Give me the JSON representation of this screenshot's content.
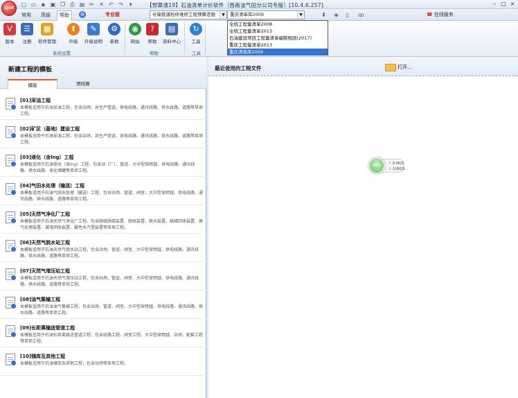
{
  "titlebar": {
    "logo_text": "Lyst",
    "title": "【预算通19】石油清单计价软件（西南油气田分公司专版）[10.4.6.257]",
    "quick_access": [
      "new-icon",
      "open-icon",
      "save-icon",
      "save-all-icon",
      "copy-icon",
      "print-icon",
      "preview-icon",
      "cut-icon",
      "delete-icon",
      "undo-icon",
      "redo-icon"
    ],
    "window_buttons": [
      "–",
      "□",
      "×"
    ]
  },
  "tabs": {
    "items": [
      "常用",
      "高级",
      "帮助"
    ],
    "active_index": 2,
    "edition": "专业版",
    "combo_left": "长输管道检修维修工程预算定额",
    "combo_right": "重庆清单库2009",
    "service": "在线服务"
  },
  "ribbon": {
    "buttons": [
      {
        "label": "版本",
        "icon": "version-icon",
        "color": "#d43a3a",
        "glyph": "V"
      },
      {
        "label": "注册",
        "icon": "register-icon",
        "color": "#3b6cb8",
        "glyph": "☰"
      },
      {
        "label": "软件管理",
        "icon": "software-manage-icon",
        "color": "#e2a21c",
        "glyph": "▦"
      },
      {
        "label": "升级",
        "icon": "upgrade-icon",
        "color": "#e8821c",
        "glyph": "⬆"
      },
      {
        "label": "升级说明",
        "icon": "upgrade-notes-icon",
        "color": "#3a7bd0",
        "glyph": "✎"
      },
      {
        "label": "参数",
        "icon": "parameters-icon",
        "color": "#2d6cc4",
        "glyph": "⚙"
      },
      {
        "label": "网站",
        "icon": "website-icon",
        "color": "#2a9a3e",
        "glyph": "◉"
      },
      {
        "label": "帮助",
        "icon": "help-icon",
        "color": "#c92a2a",
        "glyph": "?"
      },
      {
        "label": "资料中心",
        "icon": "data-center-icon",
        "color": "#3b6cb8",
        "glyph": "▤"
      },
      {
        "label": "工具",
        "icon": "tools-icon",
        "color": "#2d7fd8",
        "glyph": "↻"
      }
    ],
    "groups": [
      "系统设置",
      "帮助",
      "工具"
    ]
  },
  "dropdown": {
    "options": [
      "全统工程量清单2008",
      "全统工程量清单2013",
      "石油建设项目工程量清单编制规则(2017)",
      "重庆工程量清单2013",
      "重庆清单库2009"
    ],
    "selected_index": 4
  },
  "left_panel": {
    "title": "新建工程的模板",
    "tabs": [
      "模版",
      "预结算"
    ],
    "active_tab": 0,
    "items": [
      {
        "name": "[01]采油工程",
        "desc": "本模板适用于石油采油工程，包含站场、井生产管道、供电线路、通讯线路、供水线路、道路等单项工程。"
      },
      {
        "name": "[02]矿区（基地）建设工程",
        "desc": "本模板适用于石油采油工程，包含站场、井生产管道、供电线路、通讯线路、供水线路、道路等单项工程。"
      },
      {
        "name": "[03]液化（含lng）工程",
        "desc": "本模板适用于石油液化（含lng）工程，包含站（厂）、管道、大中型穿跨越、供电线路、通讯线路、供水线路、液化储罐等单项工程。"
      },
      {
        "name": "[04]气田水处理（输送）工程",
        "desc": "本模板适用于石油气田水处理（输送）工程，包含站场、管道、阀室、大中型穿跨越、供电线路、通讯线路、供水线路、道路等单项工程。"
      },
      {
        "name": "[05]天然气净化厂工程",
        "desc": "本模板适用于石油天然气净化厂工程，包含脱硫脱碳装置、脱硫装置、脱水装置、硫磺回收装置、尾气处理装置、凝液回收装置、酸性水汽提装置等单项工程。"
      },
      {
        "name": "[06]天然气脱水站工程",
        "desc": "本模板适用于石油天然气脱水站工程，包含站场、管道、阀室、大中型穿跨越、供电线路、通讯线路、供水线路、道路等单项工程。"
      },
      {
        "name": "[07]天然气增压站工程",
        "desc": "本模板适用于石油天然气增压站工程，包含站场、管道、阀室、大中型穿跨越、供电线路、通讯线路、供水线路、道路等单项工程。"
      },
      {
        "name": "[08]油气集输工程",
        "desc": "本模板适用于石油油气集输工程，包含站场、管道、阀室、大中型穿跨越、供电线路、通讯线路、供水线路、道路等单项工程。"
      },
      {
        "name": "[09]长距离输送管道工程",
        "desc": "本模板适用于石油长距离输送管道工程，包含线路工程、阀室工程、大中型穿跨越、站场、配套工程等单项工程。"
      },
      {
        "name": "[10]储库及其他工程",
        "desc": "本模板适用于石油储库及其他工程，包含站场等单项工程。"
      }
    ]
  },
  "right_panel": {
    "title": "最近使用的工程文件",
    "open_label": "打开...",
    "net": {
      "percent": "49%",
      "up": "0.0K/S",
      "down": "126K/S"
    }
  }
}
